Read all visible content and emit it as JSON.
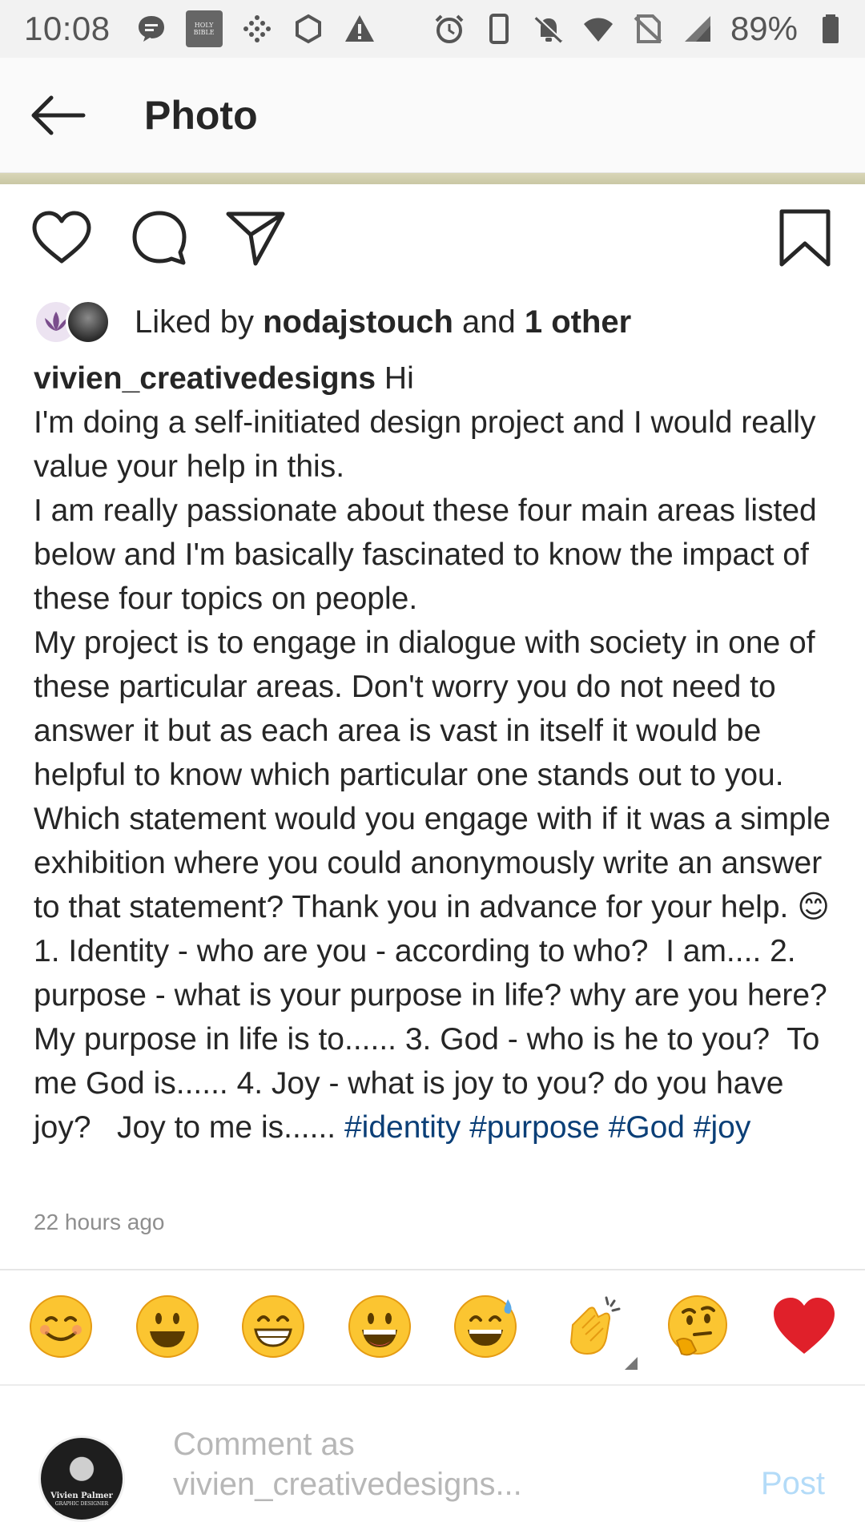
{
  "status_bar": {
    "time": "10:08",
    "battery_percent": "89%",
    "bible_icon_text": "HOLY BIBLE",
    "icons_left": [
      "message-icon",
      "bible-app-icon",
      "dots-grid-icon",
      "sync-icon",
      "alert-icon"
    ],
    "icons_right": [
      "alarm-icon",
      "phone-icon",
      "mute-icon",
      "wifi-icon",
      "no-sim-icon",
      "signal-icon",
      "battery-icon"
    ]
  },
  "app_bar": {
    "title": "Photo"
  },
  "likes": {
    "prefix": "Liked by ",
    "user": "nodajstouch",
    "middle": " and ",
    "others": "1 other"
  },
  "caption": {
    "username": "vivien_creativedesigns",
    "text": " Hi\nI'm doing a self-initiated design project and I would really value your help in this.\nI am really passionate about these four main areas listed below and I'm basically fascinated to know the impact of these four topics on people.\nMy project is to engage in dialogue with society in one of these particular areas. Don't worry you do not need to answer it but as each area is vast in itself it would be helpful to know which particular one stands out to you. Which statement would you engage with if it was a simple exhibition where you could anonymously write an answer to that statement? Thank you in advance for your help. 😊  1. Identity - who are you - according to who?  I am.... 2. purpose - what is your purpose in life? why are you here?  My purpose in life is to...... 3. God - who is he to you?  To me God is...... 4. Joy - what is joy to you? do you have joy?   Joy to me is...... ",
    "hashtags": [
      "#identity",
      "#purpose",
      "#God",
      "#joy"
    ]
  },
  "timestamp": "22 hours ago",
  "emoji_bar": [
    "😊",
    "😃",
    "😁",
    "😀",
    "😅",
    "👏",
    "🤔",
    "❤️"
  ],
  "comment": {
    "placeholder": "Comment as vivien_creativedesigns...",
    "post_label": "Post",
    "avatar_name": "Vivien Palmer",
    "avatar_title": "GRAPHIC DESIGNER"
  },
  "colors": {
    "hashtag": "#0b3f77",
    "post_disabled": "#b3dbf8",
    "timestamp": "#8e8e8e"
  }
}
